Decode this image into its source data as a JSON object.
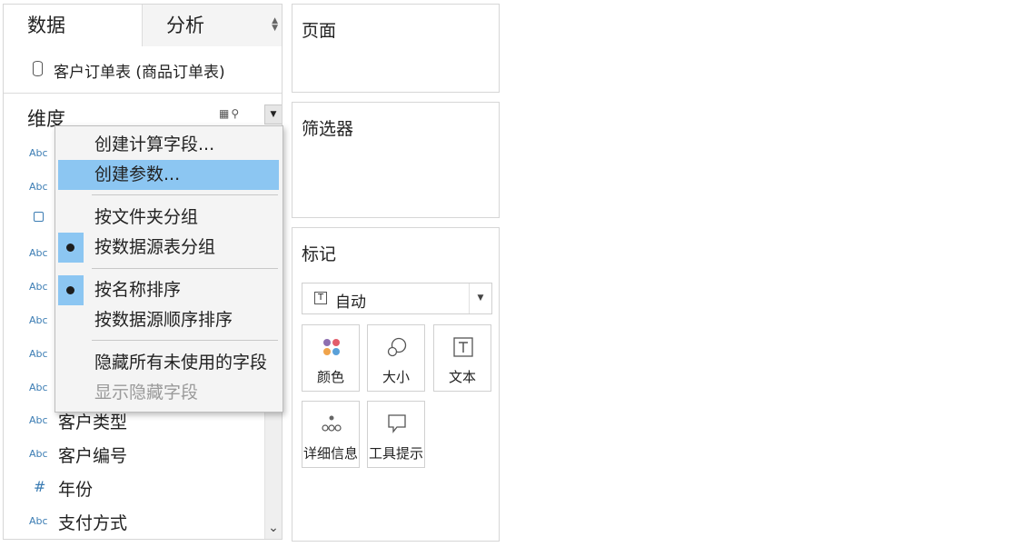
{
  "tabs": {
    "data": "数据",
    "analysis": "分析"
  },
  "datasource": {
    "label": "客户订单表 (商品订单表)"
  },
  "dimensions": {
    "title": "维度",
    "fields": [
      {
        "type": "Abc",
        "label": ""
      },
      {
        "type": "Abc",
        "label": ""
      },
      {
        "type": "date",
        "label": ""
      },
      {
        "type": "Abc",
        "label": ""
      },
      {
        "type": "Abc",
        "label": ""
      },
      {
        "type": "Abc",
        "label": ""
      },
      {
        "type": "Abc",
        "label": ""
      },
      {
        "type": "Abc",
        "label": ""
      },
      {
        "type": "Abc",
        "label": "客户类型"
      },
      {
        "type": "Abc",
        "label": "客户编号"
      },
      {
        "type": "#",
        "label": "年份"
      },
      {
        "type": "Abc",
        "label": "支付方式"
      }
    ]
  },
  "context_menu": {
    "items": [
      {
        "label": "创建计算字段...",
        "highlighted": false,
        "checked": false,
        "disabled": false
      },
      {
        "label": "创建参数...",
        "highlighted": true,
        "checked": false,
        "disabled": false
      },
      {
        "label": "按文件夹分组",
        "highlighted": false,
        "checked": false,
        "disabled": false
      },
      {
        "label": "按数据源表分组",
        "highlighted": false,
        "checked": true,
        "disabled": false
      },
      {
        "label": "按名称排序",
        "highlighted": false,
        "checked": true,
        "disabled": false
      },
      {
        "label": "按数据源顺序排序",
        "highlighted": false,
        "checked": false,
        "disabled": false
      },
      {
        "label": "隐藏所有未使用的字段",
        "highlighted": false,
        "checked": false,
        "disabled": false
      },
      {
        "label": "显示隐藏字段",
        "highlighted": false,
        "checked": false,
        "disabled": true
      }
    ]
  },
  "pages_panel": {
    "title": "页面"
  },
  "filters_panel": {
    "title": "筛选器"
  },
  "marks_panel": {
    "title": "标记",
    "type_select": "自动",
    "buttons": [
      {
        "label": "颜色",
        "icon": "color-icon"
      },
      {
        "label": "大小",
        "icon": "size-icon"
      },
      {
        "label": "文本",
        "icon": "text-icon"
      },
      {
        "label": "详细信息",
        "icon": "detail-icon"
      },
      {
        "label": "工具提示",
        "icon": "tooltip-icon"
      }
    ]
  },
  "colors": {
    "highlight": "#8cc6f2",
    "field_icon": "#3b7cb3",
    "dot_colors": [
      "#8e6fb0",
      "#e25d6b",
      "#f0a44b",
      "#5aa0d8"
    ]
  }
}
